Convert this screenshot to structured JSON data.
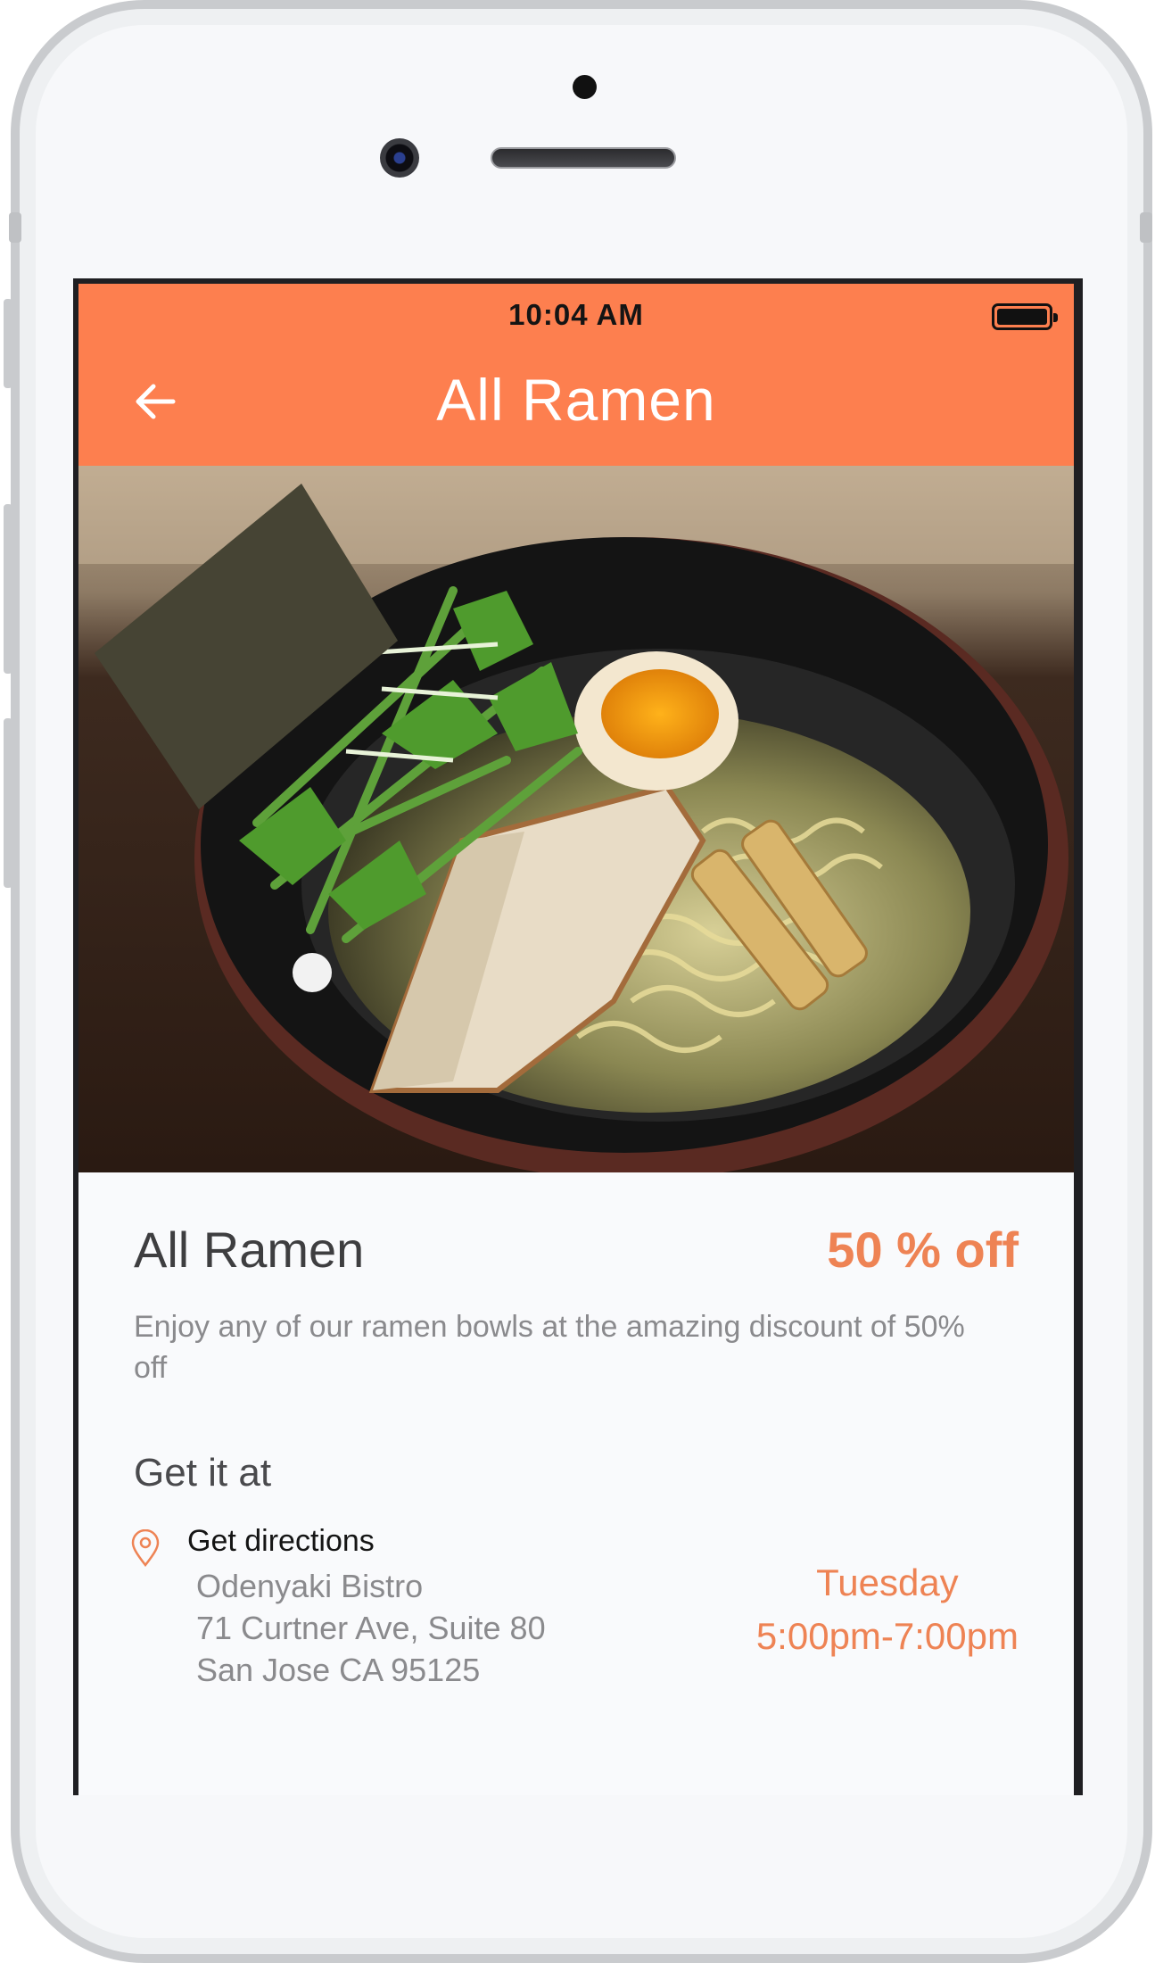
{
  "status_bar": {
    "time": "10:04 AM"
  },
  "nav": {
    "title": "All Ramen"
  },
  "hero": {
    "image_alt": "Bowl of ramen with nori, greens, egg and pork"
  },
  "deal": {
    "title": "All Ramen",
    "discount": "50 % off",
    "description": "Enjoy any of our ramen bowls at the amazing discount of 50% off"
  },
  "location": {
    "heading": "Get it at",
    "directions_label": "Get directions",
    "place_name": "Odenyaki Bistro",
    "street": "71 Curtner Ave, Suite 80",
    "city": "San Jose CA 95125",
    "day": "Tuesday",
    "hours": "5:00pm-7:00pm"
  },
  "colors": {
    "accent": "#fd7f4f",
    "accent_text": "#ee8354"
  }
}
